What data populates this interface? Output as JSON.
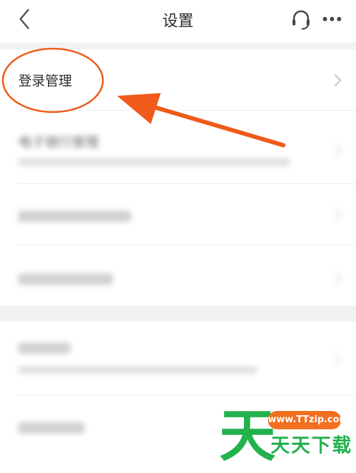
{
  "header": {
    "title": "设置",
    "back_icon": "chevron-left-icon",
    "support_icon": "headset-icon",
    "more_icon": "more-dots-icon"
  },
  "settings": {
    "items": [
      {
        "label": "登录管理",
        "blurred": false
      },
      {
        "label": "电子银行管理",
        "subtitle": "…",
        "blurred": true
      },
      {
        "label": "…",
        "blurred": true
      },
      {
        "label": "…",
        "blurred": true
      },
      {
        "label": "…",
        "subtitle": "…",
        "blurred": true
      },
      {
        "label": "…",
        "blurred": true
      }
    ]
  },
  "annotation": {
    "color": "#f05a1a",
    "shapes": [
      "circle",
      "arrow"
    ]
  },
  "watermark": {
    "big_char": "天",
    "url": "www.TTzip.com",
    "text": "天天下载",
    "colors": {
      "green": "#22b14c",
      "orange": "#f07020"
    }
  }
}
